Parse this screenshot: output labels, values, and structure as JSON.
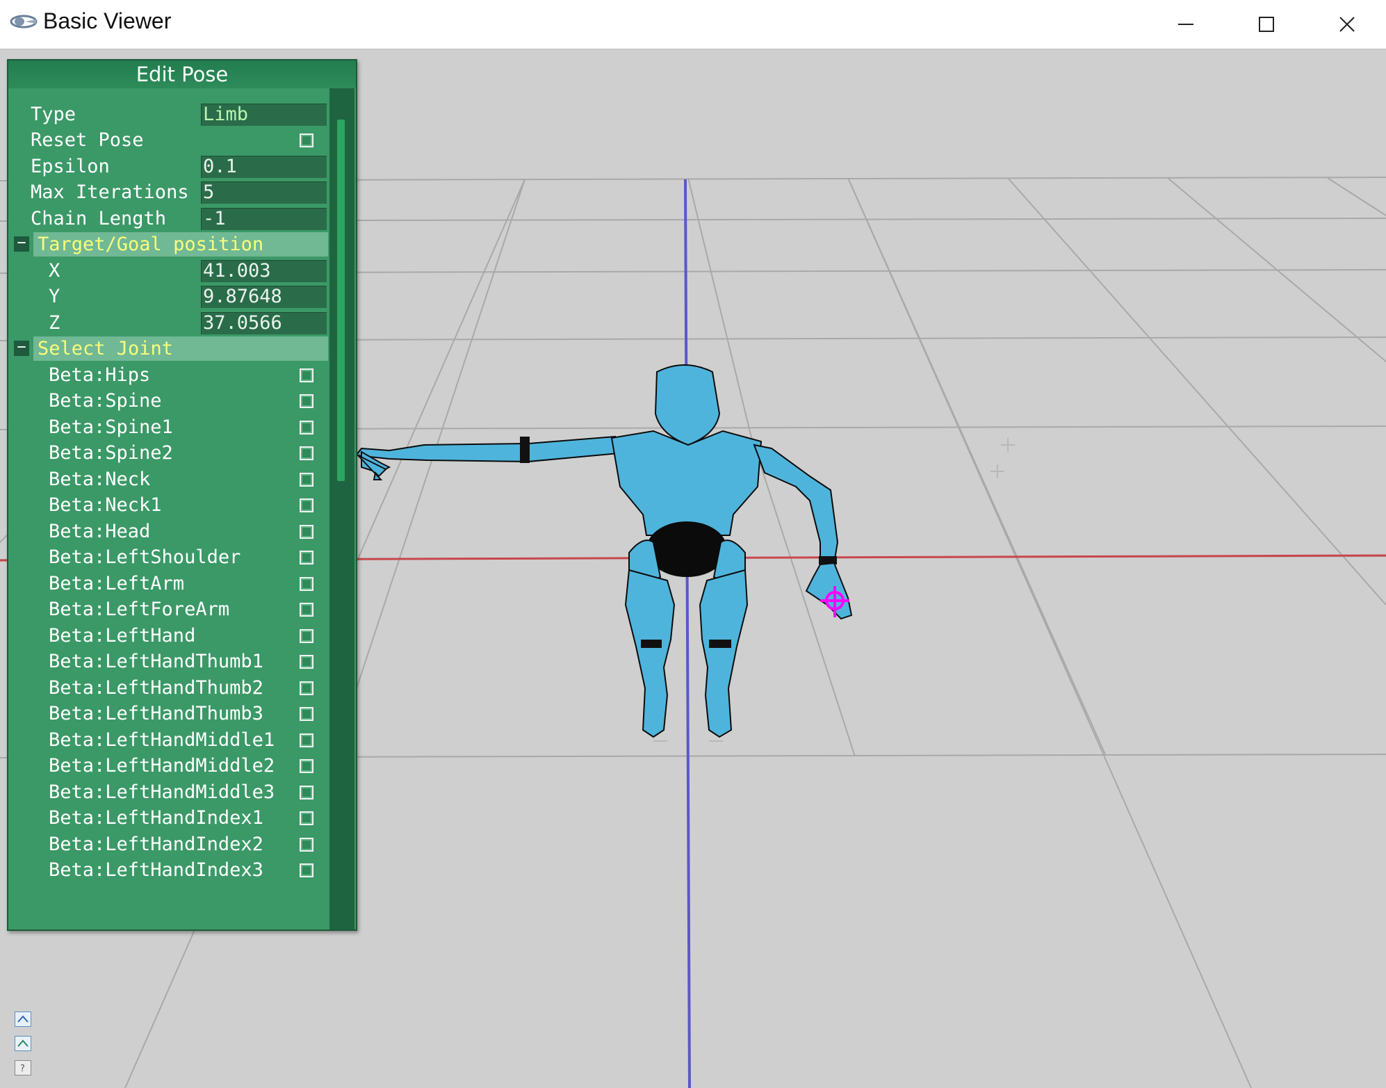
{
  "window": {
    "title": "Basic Viewer",
    "icon": "app-logo-icon",
    "controls": [
      "minimize-icon",
      "maximize-icon",
      "close-icon"
    ]
  },
  "panel": {
    "title": "Edit Pose",
    "fields": [
      {
        "label": "Type",
        "value": "Limb"
      },
      {
        "label": "Reset Pose"
      },
      {
        "label": "Epsilon",
        "value": "0.1"
      },
      {
        "label": "Max Iterations",
        "value": "5"
      },
      {
        "label": "Chain Length",
        "value": "-1"
      }
    ],
    "target_group": {
      "toggle": "−",
      "label": "Target/Goal position",
      "coords": [
        {
          "label": "X",
          "value": "41.003"
        },
        {
          "label": "Y",
          "value": "9.87648"
        },
        {
          "label": "Z",
          "value": "37.0566"
        }
      ]
    },
    "joint_group": {
      "toggle": "−",
      "label": "Select Joint",
      "joints": [
        "Beta:Hips",
        "Beta:Spine",
        "Beta:Spine1",
        "Beta:Spine2",
        "Beta:Neck",
        "Beta:Neck1",
        "Beta:Head",
        "Beta:LeftShoulder",
        "Beta:LeftArm",
        "Beta:LeftForeArm",
        "Beta:LeftHand",
        "Beta:LeftHandThumb1",
        "Beta:LeftHandThumb2",
        "Beta:LeftHandThumb3",
        "Beta:LeftHandMiddle1",
        "Beta:LeftHandMiddle2",
        "Beta:LeftHandMiddle3",
        "Beta:LeftHandIndex1",
        "Beta:LeftHandIndex2",
        "Beta:LeftHandIndex3"
      ]
    }
  },
  "colors": {
    "panel_bg": "#3b9967",
    "group_label": "#f8ff7a",
    "type_value": "#b9f5b2",
    "axis_x": "#c8474b",
    "axis_y": "#5b57c9",
    "character": "#4fb4dc",
    "target_marker": "#ff00ff"
  },
  "corner_icons": [
    "expand-icon",
    "expand-alt-icon",
    "help-icon"
  ]
}
